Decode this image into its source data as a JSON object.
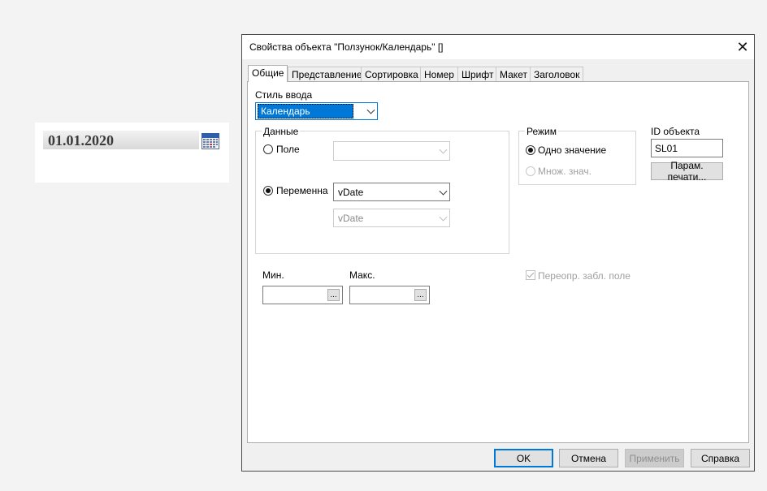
{
  "widget": {
    "date": "01.01.2020",
    "icon": "calendar-icon"
  },
  "dialog": {
    "title": "Свойства объекта \"Ползунок/Календарь\" []",
    "close_icon": "close-icon",
    "tabs": [
      {
        "label": "Общие",
        "active": true
      },
      {
        "label": "Представление"
      },
      {
        "label": "Сортировка"
      },
      {
        "label": "Номер"
      },
      {
        "label": "Шрифт"
      },
      {
        "label": "Макет"
      },
      {
        "label": "Заголовок"
      }
    ],
    "input_style": {
      "label": "Стиль ввода",
      "value": "Календарь"
    },
    "data_group": {
      "title": "Данные",
      "field_label": "Поле",
      "field_value": "",
      "variable_label": "Переменна",
      "variable_value": "vDate",
      "variable_value2": "vDate"
    },
    "mode_group": {
      "title": "Режим",
      "single": "Одно значение",
      "multi": "Множ. знач."
    },
    "object_id": {
      "label": "ID объекта",
      "value": "SL01",
      "print_button": "Парам. печати..."
    },
    "min": {
      "label": "Мин.",
      "value": "",
      "ellipsis": "..."
    },
    "max": {
      "label": "Макс.",
      "value": "",
      "ellipsis": "..."
    },
    "override_checkbox": {
      "label": "Переопр. забл. поле",
      "checked": true
    },
    "buttons": {
      "ok": "OK",
      "cancel": "Отмена",
      "apply": "Применить",
      "help": "Справка"
    }
  }
}
